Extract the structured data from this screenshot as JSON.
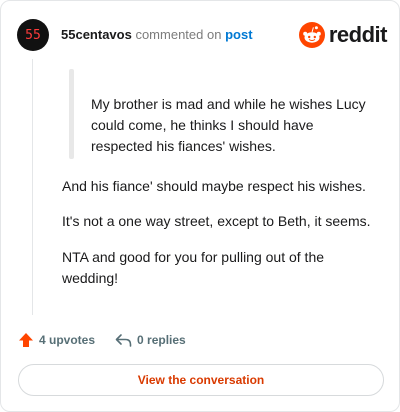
{
  "comment": {
    "avatar_text": "55",
    "username": "55centavos",
    "action_text": "commented on",
    "post_link": "post"
  },
  "brand": {
    "wordmark": "reddit",
    "logo_icon": "reddit-snoo-icon",
    "accent": "#ff4500"
  },
  "body": {
    "quote": "My brother is mad and while he wishes Lucy could come, he thinks I should have respected his fiances' wishes.",
    "paragraphs": [
      "And his fiance' should maybe respect his wishes.",
      "It's not a one way street, except to Beth, it seems.",
      "NTA and good for you for pulling out of the wedding!"
    ]
  },
  "footer": {
    "upvotes": "4 upvotes",
    "replies": "0 replies",
    "view_button": "View the conversation"
  },
  "colors": {
    "upvote": "#ff4500",
    "link": "#0079d3",
    "button_text": "#d93a00"
  }
}
